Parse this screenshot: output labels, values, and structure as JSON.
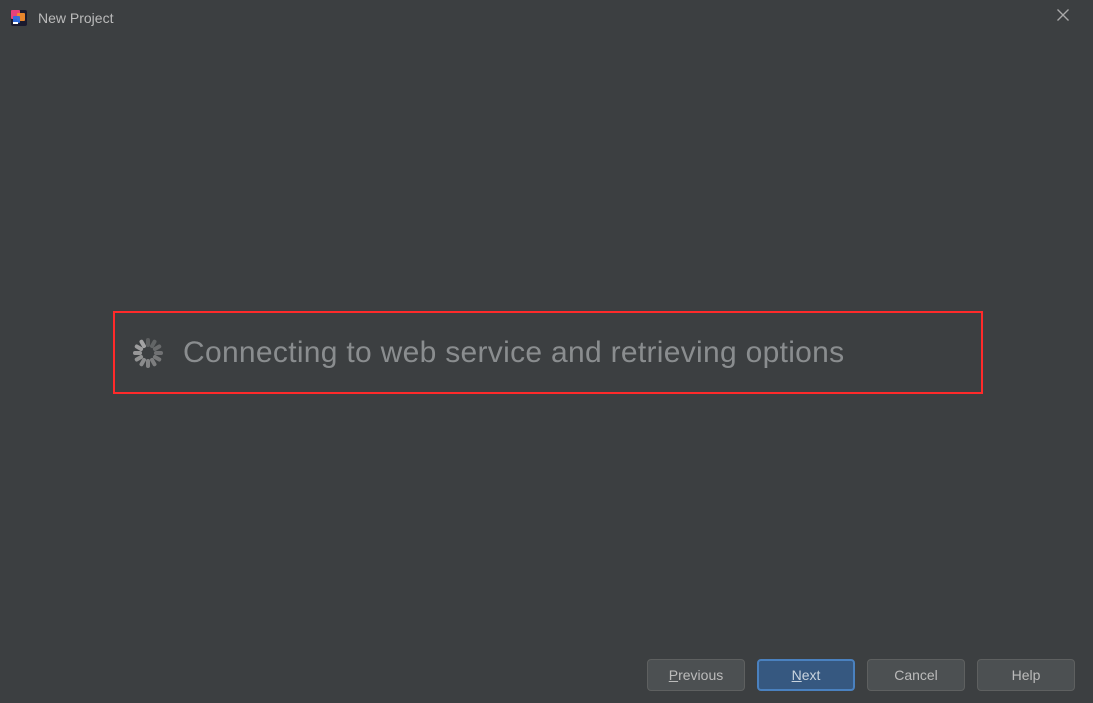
{
  "window": {
    "title": "New Project"
  },
  "loading": {
    "message": "Connecting to web service and retrieving options"
  },
  "buttons": {
    "previous": {
      "mnemonic": "P",
      "rest": "revious"
    },
    "next": {
      "mnemonic": "N",
      "rest": "ext"
    },
    "cancel": "Cancel",
    "help": "Help"
  }
}
